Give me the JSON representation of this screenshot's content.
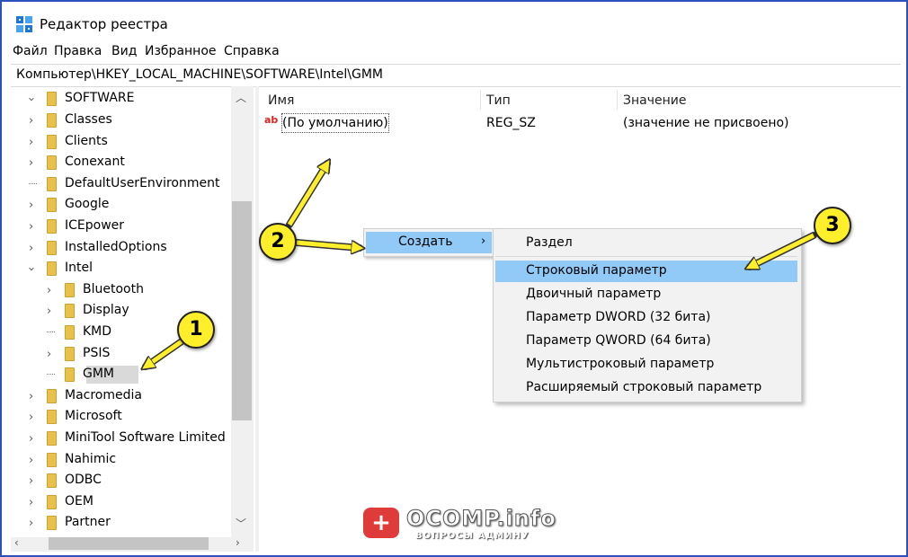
{
  "window": {
    "title": "Редактор реестра",
    "border_color": "#2b52b8"
  },
  "menu": [
    "Файл",
    "Правка",
    "Вид",
    "Избранное",
    "Справка"
  ],
  "address": "Компьютер\\HKEY_LOCAL_MACHINE\\SOFTWARE\\Intel\\GMM",
  "tree": {
    "root": "SOFTWARE",
    "items": [
      {
        "label": "Classes",
        "level": 1,
        "expander": "collapsed"
      },
      {
        "label": "Clients",
        "level": 1,
        "expander": "collapsed"
      },
      {
        "label": "Conexant",
        "level": 1,
        "expander": "collapsed"
      },
      {
        "label": "DefaultUserEnvironment",
        "level": 1,
        "expander": "none"
      },
      {
        "label": "Google",
        "level": 1,
        "expander": "collapsed"
      },
      {
        "label": "ICEpower",
        "level": 1,
        "expander": "collapsed"
      },
      {
        "label": "InstalledOptions",
        "level": 1,
        "expander": "collapsed"
      },
      {
        "label": "Intel",
        "level": 1,
        "expander": "expanded"
      },
      {
        "label": "Bluetooth",
        "level": 2,
        "expander": "collapsed"
      },
      {
        "label": "Display",
        "level": 2,
        "expander": "collapsed"
      },
      {
        "label": "KMD",
        "level": 2,
        "expander": "none"
      },
      {
        "label": "PSIS",
        "level": 2,
        "expander": "collapsed"
      },
      {
        "label": "GMM",
        "level": 2,
        "expander": "none",
        "selected": true
      },
      {
        "label": "Macromedia",
        "level": 1,
        "expander": "collapsed"
      },
      {
        "label": "Microsoft",
        "level": 1,
        "expander": "collapsed"
      },
      {
        "label": "MiniTool Software Limited",
        "level": 1,
        "expander": "collapsed"
      },
      {
        "label": "Nahimic",
        "level": 1,
        "expander": "collapsed"
      },
      {
        "label": "ODBC",
        "level": 1,
        "expander": "collapsed"
      },
      {
        "label": "OEM",
        "level": 1,
        "expander": "collapsed"
      },
      {
        "label": "Partner",
        "level": 1,
        "expander": "collapsed"
      }
    ]
  },
  "columns": {
    "name": "Имя",
    "type": "Тип",
    "value": "Значение"
  },
  "values": [
    {
      "name": "(По умолчанию)",
      "type": "REG_SZ",
      "data": "(значение не присвоено)"
    }
  ],
  "value_icon_text": "ab",
  "context_menu": {
    "create_label": "Создать",
    "submenu_arrow": "›",
    "submenu": [
      "Раздел",
      "Строковый параметр",
      "Двоичный параметр",
      "Параметр DWORD (32 бита)",
      "Параметр QWORD (64 бита)",
      "Мультистроковый параметр",
      "Расширяемый строковый параметр"
    ],
    "highlight_color": "#91c9f7"
  },
  "annotations": {
    "badges": [
      "1",
      "2",
      "3"
    ],
    "badge_color": "#ffef2b"
  },
  "watermark": {
    "icon": "+",
    "title": "OCOMP.info",
    "subtitle": "ВОПРОСЫ АДМИНУ"
  }
}
